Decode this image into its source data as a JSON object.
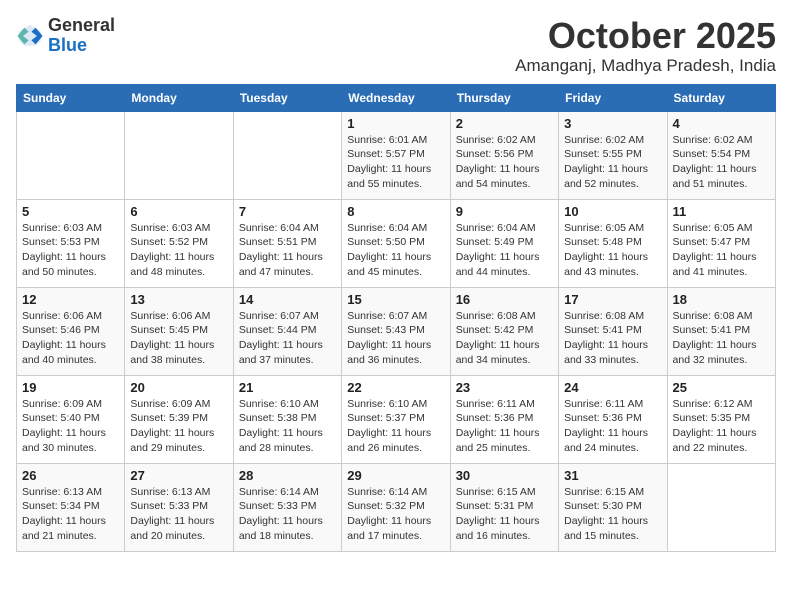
{
  "logo": {
    "general": "General",
    "blue": "Blue"
  },
  "header": {
    "month": "October 2025",
    "location": "Amanganj, Madhya Pradesh, India"
  },
  "weekdays": [
    "Sunday",
    "Monday",
    "Tuesday",
    "Wednesday",
    "Thursday",
    "Friday",
    "Saturday"
  ],
  "weeks": [
    [
      {
        "num": "",
        "sunrise": "",
        "sunset": "",
        "daylight": ""
      },
      {
        "num": "",
        "sunrise": "",
        "sunset": "",
        "daylight": ""
      },
      {
        "num": "",
        "sunrise": "",
        "sunset": "",
        "daylight": ""
      },
      {
        "num": "1",
        "sunrise": "Sunrise: 6:01 AM",
        "sunset": "Sunset: 5:57 PM",
        "daylight": "Daylight: 11 hours and 55 minutes."
      },
      {
        "num": "2",
        "sunrise": "Sunrise: 6:02 AM",
        "sunset": "Sunset: 5:56 PM",
        "daylight": "Daylight: 11 hours and 54 minutes."
      },
      {
        "num": "3",
        "sunrise": "Sunrise: 6:02 AM",
        "sunset": "Sunset: 5:55 PM",
        "daylight": "Daylight: 11 hours and 52 minutes."
      },
      {
        "num": "4",
        "sunrise": "Sunrise: 6:02 AM",
        "sunset": "Sunset: 5:54 PM",
        "daylight": "Daylight: 11 hours and 51 minutes."
      }
    ],
    [
      {
        "num": "5",
        "sunrise": "Sunrise: 6:03 AM",
        "sunset": "Sunset: 5:53 PM",
        "daylight": "Daylight: 11 hours and 50 minutes."
      },
      {
        "num": "6",
        "sunrise": "Sunrise: 6:03 AM",
        "sunset": "Sunset: 5:52 PM",
        "daylight": "Daylight: 11 hours and 48 minutes."
      },
      {
        "num": "7",
        "sunrise": "Sunrise: 6:04 AM",
        "sunset": "Sunset: 5:51 PM",
        "daylight": "Daylight: 11 hours and 47 minutes."
      },
      {
        "num": "8",
        "sunrise": "Sunrise: 6:04 AM",
        "sunset": "Sunset: 5:50 PM",
        "daylight": "Daylight: 11 hours and 45 minutes."
      },
      {
        "num": "9",
        "sunrise": "Sunrise: 6:04 AM",
        "sunset": "Sunset: 5:49 PM",
        "daylight": "Daylight: 11 hours and 44 minutes."
      },
      {
        "num": "10",
        "sunrise": "Sunrise: 6:05 AM",
        "sunset": "Sunset: 5:48 PM",
        "daylight": "Daylight: 11 hours and 43 minutes."
      },
      {
        "num": "11",
        "sunrise": "Sunrise: 6:05 AM",
        "sunset": "Sunset: 5:47 PM",
        "daylight": "Daylight: 11 hours and 41 minutes."
      }
    ],
    [
      {
        "num": "12",
        "sunrise": "Sunrise: 6:06 AM",
        "sunset": "Sunset: 5:46 PM",
        "daylight": "Daylight: 11 hours and 40 minutes."
      },
      {
        "num": "13",
        "sunrise": "Sunrise: 6:06 AM",
        "sunset": "Sunset: 5:45 PM",
        "daylight": "Daylight: 11 hours and 38 minutes."
      },
      {
        "num": "14",
        "sunrise": "Sunrise: 6:07 AM",
        "sunset": "Sunset: 5:44 PM",
        "daylight": "Daylight: 11 hours and 37 minutes."
      },
      {
        "num": "15",
        "sunrise": "Sunrise: 6:07 AM",
        "sunset": "Sunset: 5:43 PM",
        "daylight": "Daylight: 11 hours and 36 minutes."
      },
      {
        "num": "16",
        "sunrise": "Sunrise: 6:08 AM",
        "sunset": "Sunset: 5:42 PM",
        "daylight": "Daylight: 11 hours and 34 minutes."
      },
      {
        "num": "17",
        "sunrise": "Sunrise: 6:08 AM",
        "sunset": "Sunset: 5:41 PM",
        "daylight": "Daylight: 11 hours and 33 minutes."
      },
      {
        "num": "18",
        "sunrise": "Sunrise: 6:08 AM",
        "sunset": "Sunset: 5:41 PM",
        "daylight": "Daylight: 11 hours and 32 minutes."
      }
    ],
    [
      {
        "num": "19",
        "sunrise": "Sunrise: 6:09 AM",
        "sunset": "Sunset: 5:40 PM",
        "daylight": "Daylight: 11 hours and 30 minutes."
      },
      {
        "num": "20",
        "sunrise": "Sunrise: 6:09 AM",
        "sunset": "Sunset: 5:39 PM",
        "daylight": "Daylight: 11 hours and 29 minutes."
      },
      {
        "num": "21",
        "sunrise": "Sunrise: 6:10 AM",
        "sunset": "Sunset: 5:38 PM",
        "daylight": "Daylight: 11 hours and 28 minutes."
      },
      {
        "num": "22",
        "sunrise": "Sunrise: 6:10 AM",
        "sunset": "Sunset: 5:37 PM",
        "daylight": "Daylight: 11 hours and 26 minutes."
      },
      {
        "num": "23",
        "sunrise": "Sunrise: 6:11 AM",
        "sunset": "Sunset: 5:36 PM",
        "daylight": "Daylight: 11 hours and 25 minutes."
      },
      {
        "num": "24",
        "sunrise": "Sunrise: 6:11 AM",
        "sunset": "Sunset: 5:36 PM",
        "daylight": "Daylight: 11 hours and 24 minutes."
      },
      {
        "num": "25",
        "sunrise": "Sunrise: 6:12 AM",
        "sunset": "Sunset: 5:35 PM",
        "daylight": "Daylight: 11 hours and 22 minutes."
      }
    ],
    [
      {
        "num": "26",
        "sunrise": "Sunrise: 6:13 AM",
        "sunset": "Sunset: 5:34 PM",
        "daylight": "Daylight: 11 hours and 21 minutes."
      },
      {
        "num": "27",
        "sunrise": "Sunrise: 6:13 AM",
        "sunset": "Sunset: 5:33 PM",
        "daylight": "Daylight: 11 hours and 20 minutes."
      },
      {
        "num": "28",
        "sunrise": "Sunrise: 6:14 AM",
        "sunset": "Sunset: 5:33 PM",
        "daylight": "Daylight: 11 hours and 18 minutes."
      },
      {
        "num": "29",
        "sunrise": "Sunrise: 6:14 AM",
        "sunset": "Sunset: 5:32 PM",
        "daylight": "Daylight: 11 hours and 17 minutes."
      },
      {
        "num": "30",
        "sunrise": "Sunrise: 6:15 AM",
        "sunset": "Sunset: 5:31 PM",
        "daylight": "Daylight: 11 hours and 16 minutes."
      },
      {
        "num": "31",
        "sunrise": "Sunrise: 6:15 AM",
        "sunset": "Sunset: 5:30 PM",
        "daylight": "Daylight: 11 hours and 15 minutes."
      },
      {
        "num": "",
        "sunrise": "",
        "sunset": "",
        "daylight": ""
      }
    ]
  ]
}
